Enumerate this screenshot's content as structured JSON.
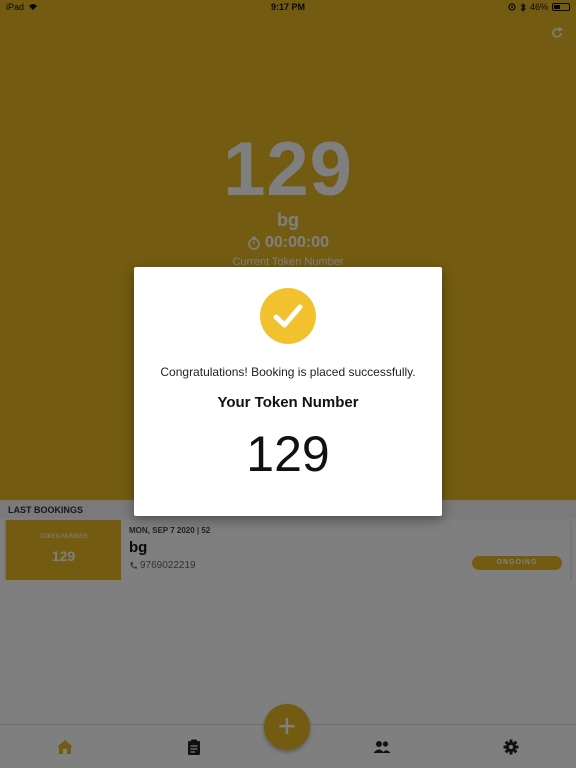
{
  "status_bar": {
    "carrier": "iPad",
    "time": "9:17 PM",
    "battery": "46%",
    "battery_level": 0.46
  },
  "hero": {
    "token_number": "129",
    "name": "bg",
    "timer": "00:00:00",
    "caption": "Current Token Number"
  },
  "last_bookings": {
    "header": "LAST BOOKINGS",
    "items": [
      {
        "token_label": "TOKEN NUMBER",
        "token": "129",
        "date": "MON, SEP 7 2020 | 52",
        "name": "bg",
        "phone": "9769022219",
        "status": "ONGOING"
      }
    ]
  },
  "dialog": {
    "message": "Congratulations! Booking is placed successfully.",
    "token_title": "Your Token Number",
    "token_number": "129"
  },
  "nav": {
    "items": [
      "home-icon",
      "clipboard-icon",
      "people-icon",
      "gear-icon"
    ],
    "fab_symbol": "+"
  },
  "colors": {
    "accent": "#e7b923",
    "check": "#f2c12e"
  }
}
